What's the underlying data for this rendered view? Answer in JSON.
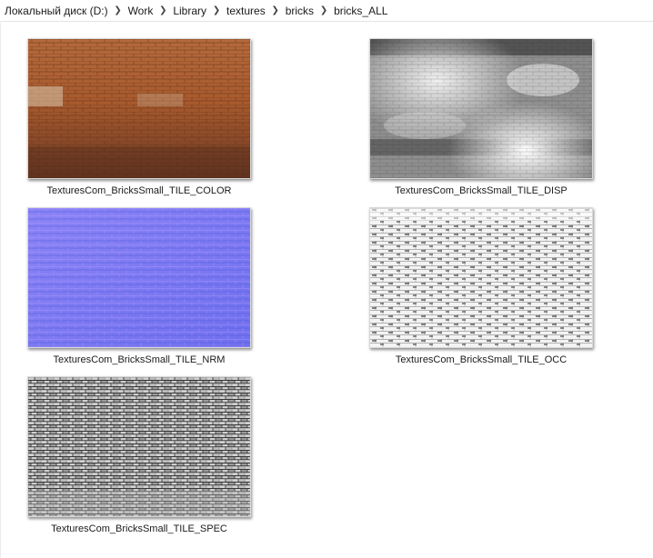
{
  "breadcrumb": {
    "items": [
      {
        "label": "Локальный диск (D:)"
      },
      {
        "label": "Work"
      },
      {
        "label": "Library"
      },
      {
        "label": "textures"
      },
      {
        "label": "bricks"
      },
      {
        "label": "bricks_ALL"
      }
    ]
  },
  "files": [
    {
      "name": "TexturesCom_BricksSmall_TILE_COLOR",
      "thumbnail": "red-brick-wall-color-map"
    },
    {
      "name": "TexturesCom_BricksSmall_TILE_DISP",
      "thumbnail": "grayscale-displacement-map"
    },
    {
      "name": "TexturesCom_BricksSmall_TILE_NRM",
      "thumbnail": "blue-purple-normal-map"
    },
    {
      "name": "TexturesCom_BricksSmall_TILE_OCC",
      "thumbnail": "white-ambient-occlusion-map"
    },
    {
      "name": "TexturesCom_BricksSmall_TILE_SPEC",
      "thumbnail": "gray-specular-map"
    }
  ],
  "colors": {
    "brick": "#a8582e",
    "normal": "#7b78f2",
    "disp": "#9a9a9a",
    "occ": "#f2f2f2",
    "spec": "#8a8a8a"
  }
}
